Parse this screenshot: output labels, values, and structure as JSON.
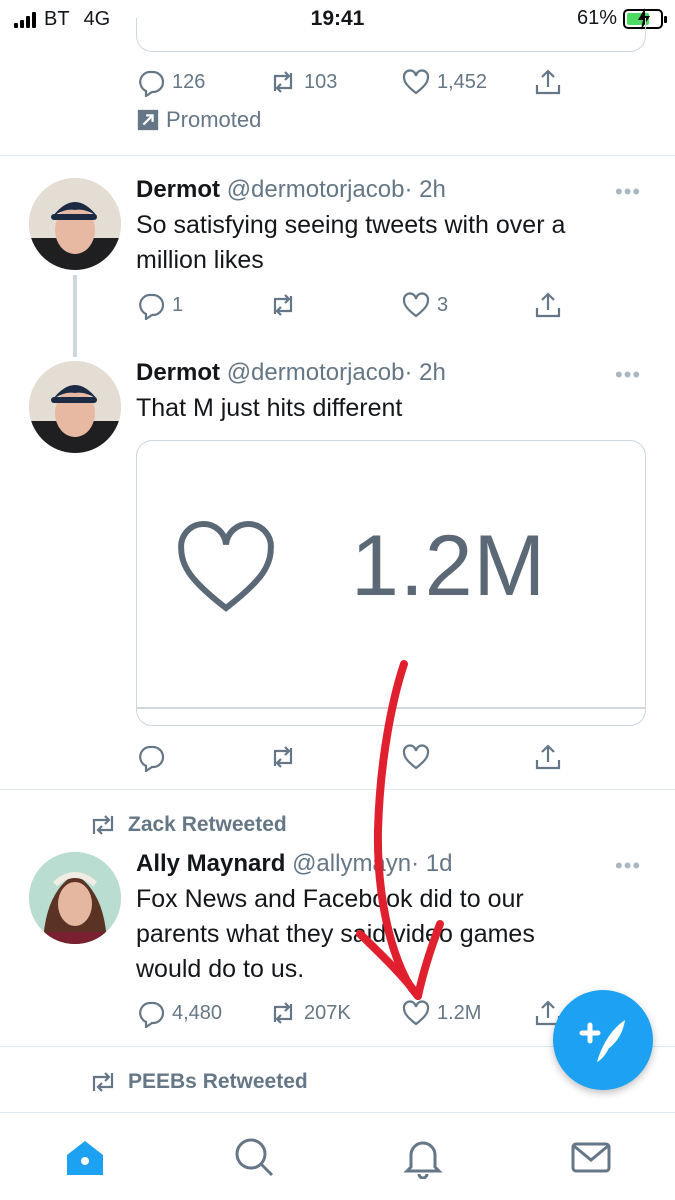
{
  "status_bar": {
    "carrier": "BT",
    "network": "4G",
    "time": "19:41",
    "battery": "61%"
  },
  "promoted_tweet": {
    "replies": "126",
    "retweets": "103",
    "likes": "1,452",
    "promoted_label": "Promoted"
  },
  "tweets": [
    {
      "name": "Dermot",
      "handle": "@dermotorjacob",
      "time": "· 2h",
      "text_line1": "So satisfying seeing tweets with over a",
      "text_line2": "million likes",
      "replies": "1",
      "retweets": "",
      "likes": "3"
    },
    {
      "name": "Dermot",
      "handle": "@dermotorjacob",
      "time": "· 2h",
      "text_line1": "That M just hits different",
      "media_count": "1.2M",
      "replies": "",
      "retweets": "",
      "likes": ""
    },
    {
      "retweeted_by": "Zack Retweeted",
      "name": "Ally Maynard",
      "handle": "@allymayn",
      "time": "· 1d",
      "text_line1": "Fox News and Facebook did to our",
      "text_line2": "parents what they said video games",
      "text_line3": "would do to us.",
      "replies": "4,480",
      "retweets": "207K",
      "likes": "1.2M"
    }
  ],
  "next_retweeted": "PEEBs Retweeted",
  "more_glyph": "•••",
  "icons": {
    "reply": "reply-icon",
    "retweet": "retweet-icon",
    "like": "heart-icon",
    "share": "share-icon",
    "compose": "compose-tweet-icon",
    "home": "home-icon",
    "search": "search-icon",
    "notifications": "bell-icon",
    "messages": "mail-icon"
  },
  "colors": {
    "accent": "#1da1f2",
    "muted": "#657786",
    "annotation": "#e0202e"
  }
}
